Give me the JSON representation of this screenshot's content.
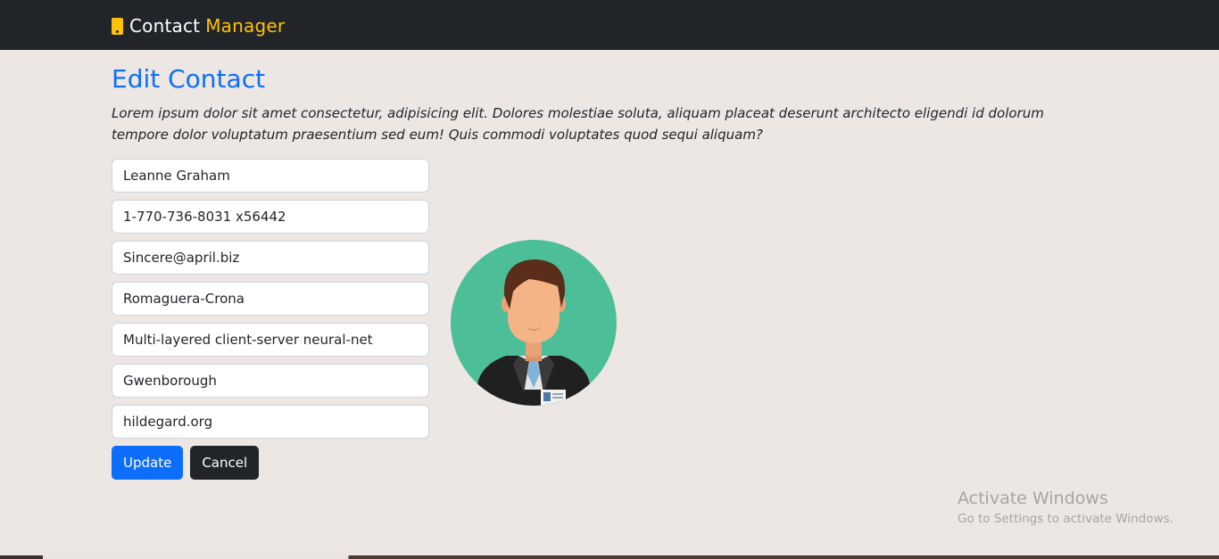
{
  "navbar": {
    "brand_main": "Contact",
    "brand_accent": "Manager",
    "brand_icon": "mobile-phone-icon",
    "accent_color": "#ffc107"
  },
  "page": {
    "title": "Edit Contact",
    "description": "Lorem ipsum dolor sit amet consectetur, adipisicing elit. Dolores molestiae soluta, aliquam placeat deserunt architecto eligendi id dolorum tempore dolor voluptatum praesentium sed eum! Quis commodi voluptates quod sequi aliquam?"
  },
  "form": {
    "name": "Leanne Graham",
    "phone": "1-770-736-8031 x56442",
    "email": "Sincere@april.biz",
    "company": "Romaguera-Crona",
    "catchphrase": "Multi-layered client-server neural-net",
    "city": "Gwenborough",
    "website": "hildegard.org"
  },
  "buttons": {
    "update": "Update",
    "cancel": "Cancel"
  },
  "avatar": {
    "icon": "person-avatar-icon",
    "background": "#4cbf98"
  },
  "watermark": {
    "title": "Activate Windows",
    "subtitle": "Go to Settings to activate Windows."
  },
  "colors": {
    "primary": "#0d6efd",
    "dark": "#212529",
    "page_bg": "#ece7e3"
  }
}
